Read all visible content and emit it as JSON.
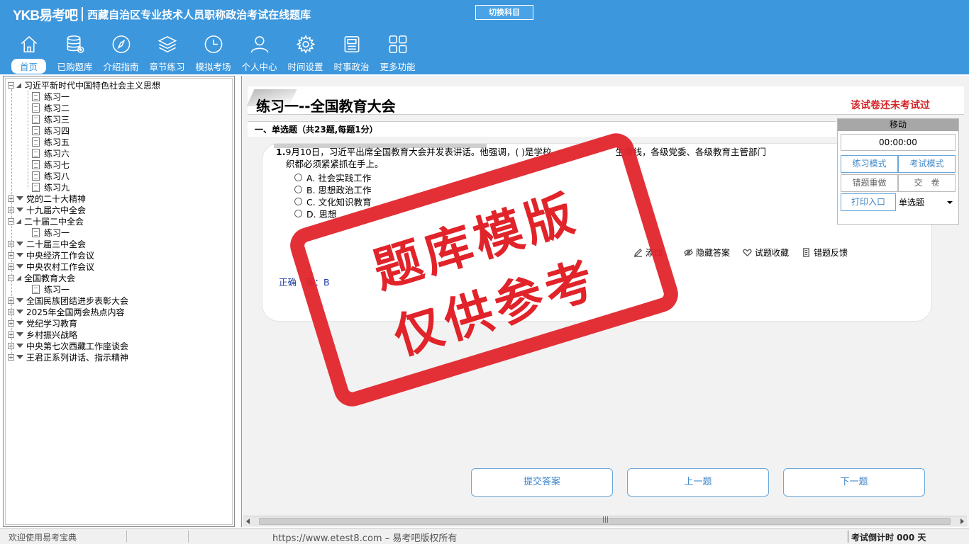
{
  "header": {
    "brand": "YKB易考吧",
    "title": "西藏自治区专业技术人员职称政治考试在线题库",
    "switch_label": "切换科目"
  },
  "nav": [
    {
      "label": "首页",
      "icon": "home-icon"
    },
    {
      "label": "已购题库",
      "icon": "database-icon"
    },
    {
      "label": "介绍指南",
      "icon": "compass-icon"
    },
    {
      "label": "章节练习",
      "icon": "layers-icon"
    },
    {
      "label": "模拟考场",
      "icon": "clock-icon"
    },
    {
      "label": "个人中心",
      "icon": "user-icon"
    },
    {
      "label": "时间设置",
      "icon": "gear-icon"
    },
    {
      "label": "时事政治",
      "icon": "news-icon"
    },
    {
      "label": "更多功能",
      "icon": "grid-icon"
    }
  ],
  "tree": {
    "root1": "习近平新时代中国特色社会主义思想",
    "root1_children": [
      "练习一",
      "练习二",
      "练习三",
      "练习四",
      "练习五",
      "练习六",
      "练习七",
      "练习八",
      "练习九"
    ],
    "n2": "党的二十大精神",
    "n3": "十九届六中全会",
    "n4": "二十届二中全会",
    "n4_child": "练习一",
    "n5": "二十届三中全会",
    "n6": "中央经济工作会议",
    "n7": "中央农村工作会议",
    "n8": "全国教育大会",
    "n8_child": "练习一",
    "n9": "全国民族团结进步表彰大会",
    "n10": "2025年全国两会热点内容",
    "n11": "党纪学习教育",
    "n12": "乡村振兴战略",
    "n13": "中央第七次西藏工作座谈会",
    "n14": "王君正系列讲话、指示精神"
  },
  "exam": {
    "title": "练习一--全国教育大会",
    "status": "该试卷还未考试过",
    "section": "一、单选题（共23题,每题1分）",
    "question_num": "1.",
    "question_line1": "9月10日，习近平出席全国教育大会并发表讲话。他强调，( )是学校",
    "question_line1_tail": "生命线，各级党委、各级教育主管部门",
    "question_line2": "织都必须紧紧抓在手上。",
    "options": [
      "A. 社会实践工作",
      "B. 思想政治工作",
      "C. 文化知识教育",
      "D. 思想"
    ],
    "tools": {
      "add_note": "添加",
      "hide_answer": "隐藏答案",
      "favorite": "试题收藏",
      "feedback": "错题反馈"
    },
    "answer_label": "正确",
    "answer_tail": "案：B"
  },
  "timer_panel": {
    "move": "移动",
    "time": "00:00:00",
    "practice_mode": "练习模式",
    "exam_mode": "考试模式",
    "redo_wrong": "错题重做",
    "submit_paper": "交　卷",
    "print": "打印入口",
    "type_selected": "单选题"
  },
  "buttons": {
    "submit": "提交答案",
    "prev": "上一题",
    "next": "下一题"
  },
  "status": {
    "welcome": "欢迎使用易考宝典",
    "url": "https://www.etest8.com – 易考吧版权所有",
    "countdown": "考试倒计时 000 天"
  },
  "stamp": {
    "line1": "题库模版",
    "line2": "仅供参考"
  },
  "colors": {
    "header_bg": "#3d97dd",
    "accent_blue": "#3f86c9",
    "alert_red": "#d3262a",
    "stamp_red": "#e1232a"
  }
}
